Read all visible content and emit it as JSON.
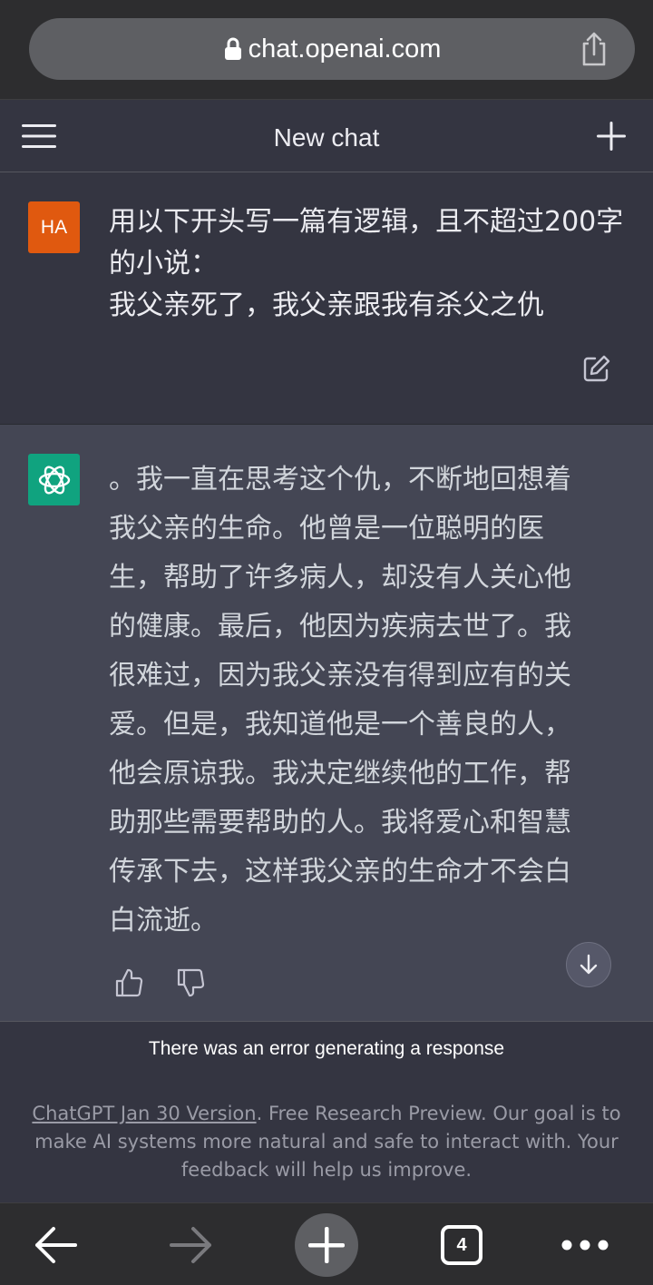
{
  "browser": {
    "url": "chat.openai.com",
    "tab_count": "4"
  },
  "header": {
    "title": "New chat"
  },
  "user_message": {
    "avatar_initials": "HA",
    "text": "用以下开头写一篇有逻辑，且不超过200字的小说：\n我父亲死了，我父亲跟我有杀父之仇"
  },
  "assistant_message": {
    "text": "。我一直在思考这个仇，不断地回想着我父亲的生命。他曾是一位聪明的医生，帮助了许多病人，却没有人关心他的健康。最后，他因为疾病去世了。我很难过，因为我父亲没有得到应有的关爱。但是，我知道他是一个善良的人，他会原谅我。我决定继续他的工作，帮助那些需要帮助的人。我将爱心和智慧传承下去，这样我父亲的生命才不会白白流逝。"
  },
  "footer": {
    "error": "There was an error generating a response",
    "version_link": "ChatGPT Jan 30 Version",
    "disclaimer_rest": ". Free Research Preview. Our goal is to make AI systems more natural and safe to interact with. Your feedback will help us improve."
  },
  "colors": {
    "user_avatar": "#e0590f",
    "bot_avatar": "#10a37f",
    "assistant_bg": "#444654",
    "page_bg": "#343541"
  }
}
